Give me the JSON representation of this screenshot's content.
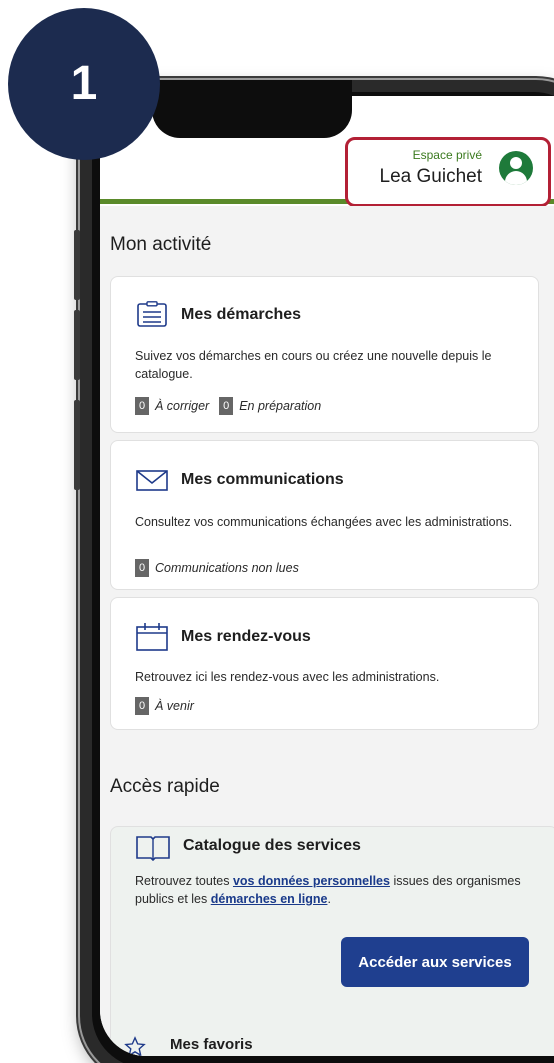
{
  "step": {
    "number": "1"
  },
  "header": {
    "account_label": "Espace privé",
    "user_name": "Lea Guichet",
    "accent_color": "#b32035",
    "bar_color": "#5a8a2a"
  },
  "activity": {
    "section_title": "Mon activité",
    "cards": [
      {
        "icon": "clipboard-icon",
        "title": "Mes démarches",
        "description": "Suivez vos démarches en cours ou créez une nouvelle depuis le catalogue.",
        "statuses": [
          {
            "count": "0",
            "label": "À corriger"
          },
          {
            "count": "0",
            "label": "En préparation"
          }
        ]
      },
      {
        "icon": "envelope-icon",
        "title": "Mes communications",
        "description": "Consultez vos communications échangées avec les administrations.",
        "statuses": [
          {
            "count": "0",
            "label": "Communications non lues"
          }
        ]
      },
      {
        "icon": "calendar-icon",
        "title": "Mes rendez-vous",
        "description": "Retrouvez ici les rendez-vous avec les administrations.",
        "statuses": [
          {
            "count": "0",
            "label": "À venir"
          }
        ]
      }
    ]
  },
  "quick_access": {
    "section_title": "Accès rapide",
    "catalogue": {
      "icon": "book-icon",
      "title": "Catalogue des services",
      "desc_before": "Retrouvez toutes ",
      "link1": "vos données personnelles",
      "desc_middle": " issues des organismes publics et les ",
      "link2": "démarches en ligne",
      "desc_after": ".",
      "button_label": "Accéder aux services",
      "button_color": "#1f3f8f"
    },
    "favorites": {
      "icon": "star-icon",
      "title": "Mes favoris"
    }
  }
}
